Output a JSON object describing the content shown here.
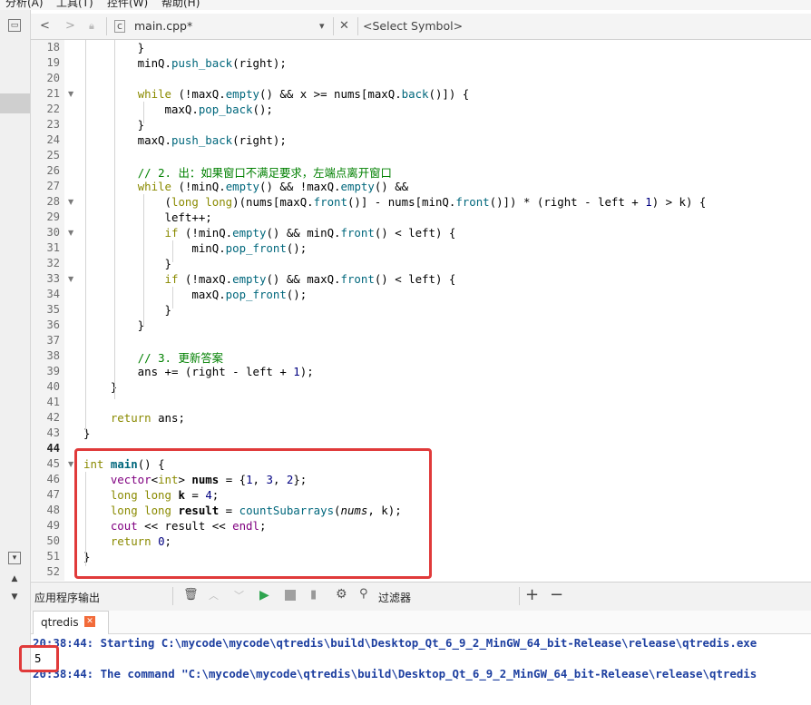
{
  "menu": {
    "items": [
      "分析(A)",
      "工具(T)",
      "控件(W)",
      "帮助(H)"
    ]
  },
  "toolbar": {
    "back": "<",
    "forward": ">",
    "file_name": "main.cpp*",
    "dropdown_arrow": "▾",
    "close": "✕",
    "symbol": "<Select Symbol>"
  },
  "editor": {
    "lines": [
      {
        "n": "18",
        "html": "        }"
      },
      {
        "n": "19",
        "html": "        minQ.<span class=\"fn\">push_back</span>(right);"
      },
      {
        "n": "20",
        "html": ""
      },
      {
        "n": "21",
        "fold": true,
        "html": "        <span class=\"kw\">while</span> (!maxQ.<span class=\"fn\">empty</span>() && x >= nums[maxQ.<span class=\"fn\">back</span>()]) {"
      },
      {
        "n": "22",
        "html": "            maxQ.<span class=\"fn\">pop_back</span>();"
      },
      {
        "n": "23",
        "html": "        }"
      },
      {
        "n": "24",
        "html": "        maxQ.<span class=\"fn\">push_back</span>(right);"
      },
      {
        "n": "25",
        "html": ""
      },
      {
        "n": "26",
        "html": "        <span class=\"cm\">// 2. 出：如果窗口不满足要求，左端点离开窗口</span>"
      },
      {
        "n": "27",
        "html": "        <span class=\"kw\">while</span> (!minQ.<span class=\"fn\">empty</span>() && !maxQ.<span class=\"fn\">empty</span>() &&"
      },
      {
        "n": "28",
        "fold": true,
        "html": "            (<span class=\"kw\">long long</span>)(nums[maxQ.<span class=\"fn\">front</span>()] - nums[minQ.<span class=\"fn\">front</span>()]) * (right - left + <span class=\"num\">1</span>) > k) {"
      },
      {
        "n": "29",
        "html": "            left++;"
      },
      {
        "n": "30",
        "fold": true,
        "html": "            <span class=\"kw\">if</span> (!minQ.<span class=\"fn\">empty</span>() && minQ.<span class=\"fn\">front</span>() < left) {"
      },
      {
        "n": "31",
        "html": "                minQ.<span class=\"fn\">pop_front</span>();"
      },
      {
        "n": "32",
        "html": "            }"
      },
      {
        "n": "33",
        "fold": true,
        "html": "            <span class=\"kw\">if</span> (!maxQ.<span class=\"fn\">empty</span>() && maxQ.<span class=\"fn\">front</span>() < left) {"
      },
      {
        "n": "34",
        "html": "                maxQ.<span class=\"fn\">pop_front</span>();"
      },
      {
        "n": "35",
        "html": "            }"
      },
      {
        "n": "36",
        "html": "        }"
      },
      {
        "n": "37",
        "html": ""
      },
      {
        "n": "38",
        "html": "        <span class=\"cm\">// 3. 更新答案</span>"
      },
      {
        "n": "39",
        "html": "        ans += (right - left + <span class=\"num\">1</span>);"
      },
      {
        "n": "40",
        "html": "    }"
      },
      {
        "n": "41",
        "html": ""
      },
      {
        "n": "42",
        "html": "    <span class=\"kw\">return</span> ans;"
      },
      {
        "n": "43",
        "html": "}"
      },
      {
        "n": "44",
        "current": true,
        "html": ""
      },
      {
        "n": "45",
        "fold": true,
        "html": "<span class=\"kw\">int</span> <b class=\"fn\">main</b>() {"
      },
      {
        "n": "46",
        "html": "    <span class=\"ty\">vector</span>&lt;<span class=\"kw\">int</span>&gt; <b>nums</b> = {<span class=\"num\">1</span>, <span class=\"num\">3</span>, <span class=\"num\">2</span>};"
      },
      {
        "n": "47",
        "html": "    <span class=\"kw\">long long</span> <b>k</b> = <span class=\"num\">4</span>;"
      },
      {
        "n": "48",
        "html": "    <span class=\"kw\">long long</span> <b>result</b> = <span class=\"fn\">countSubarrays</span>(<i>nums</i>, k);"
      },
      {
        "n": "49",
        "html": "    <span class=\"ty\">cout</span> << result << <span class=\"ty\">endl</span>;"
      },
      {
        "n": "50",
        "html": "    <span class=\"kw\">return</span> <span class=\"num\">0</span>;"
      },
      {
        "n": "51",
        "html": "}"
      },
      {
        "n": "52",
        "html": ""
      }
    ]
  },
  "output_panel": {
    "title": "应用程序输出",
    "filter_label": "过滤器",
    "plus": "+",
    "minus": "−",
    "tab_label": "qtredis",
    "tab_close": "✕",
    "lines": [
      "20:38:44: Starting C:\\mycode\\mycode\\qtredis\\build\\Desktop_Qt_6_9_2_MinGW_64_bit-Release\\release\\qtredis.exe",
      "5",
      "20:38:44: The command \"C:\\mycode\\mycode\\qtredis\\build\\Desktop_Qt_6_9_2_MinGW_64_bit-Release\\release\\qtredis"
    ]
  },
  "colors": {
    "highlight_box": "#e03a3a",
    "run_green": "#2ea44f"
  }
}
